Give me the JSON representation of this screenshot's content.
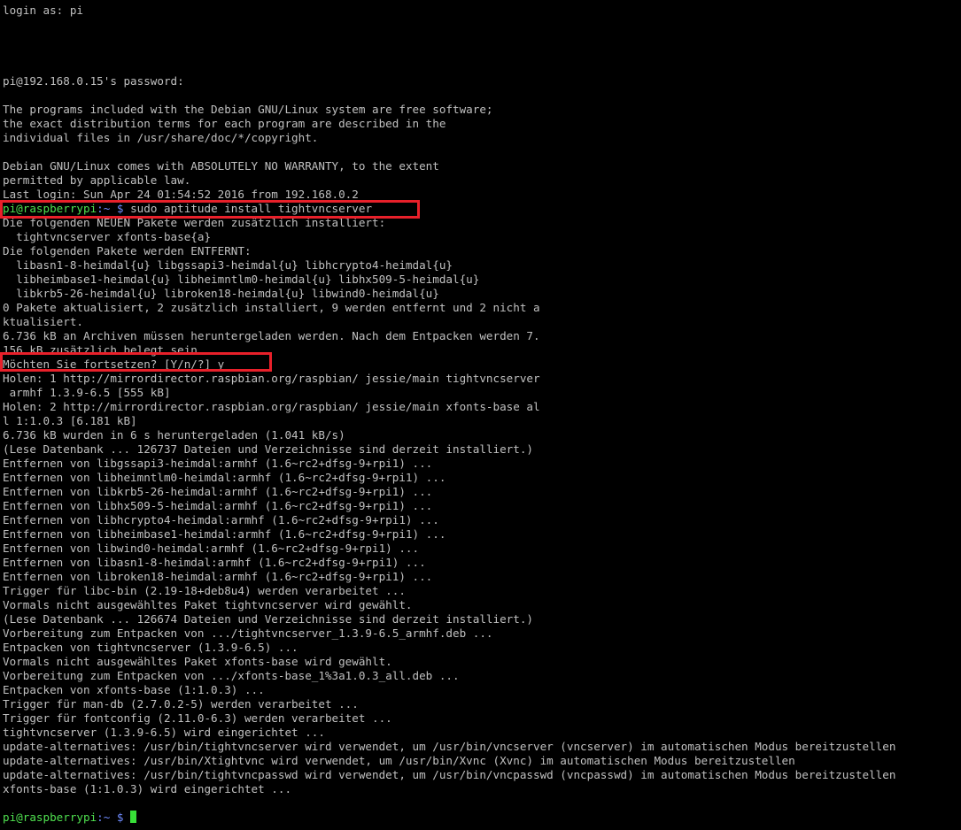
{
  "terminal": {
    "colors": {
      "background": "#000000",
      "foreground": "#c0c0c0",
      "prompt_user": "#4fe04f",
      "prompt_path": "#6f8bff",
      "highlight": "#e8202a"
    },
    "lines": [
      "login as: pi",
      "",
      "",
      "",
      "",
      "pi@192.168.0.15's password:",
      "",
      "The programs included with the Debian GNU/Linux system are free software;",
      "the exact distribution terms for each program are described in the",
      "individual files in /usr/share/doc/*/copyright.",
      "",
      "Debian GNU/Linux comes with ABSOLUTELY NO WARRANTY, to the extent",
      "permitted by applicable law.",
      "Last login: Sun Apr 24 01:54:52 2016 from 192.168.0.2"
    ],
    "command_prompt": {
      "user_host": "pi@raspberrypi",
      "path": ":~",
      "symbol": " $ ",
      "command": "sudo aptitude install tightvncserver"
    },
    "output_lines": [
      "Die folgenden NEUEN Pakete werden zusätzlich installiert:",
      "  tightvncserver xfonts-base{a}",
      "Die folgenden Pakete werden ENTFERNT:",
      "  libasn1-8-heimdal{u} libgssapi3-heimdal{u} libhcrypto4-heimdal{u}",
      "  libheimbase1-heimdal{u} libheimntlm0-heimdal{u} libhx509-5-heimdal{u}",
      "  libkrb5-26-heimdal{u} libroken18-heimdal{u} libwind0-heimdal{u}",
      "0 Pakete aktualisiert, 2 zusätzlich installiert, 9 werden entfernt und 2 nicht a",
      "ktualisiert.",
      "6.736 kB an Archiven müssen heruntergeladen werden. Nach dem Entpacken werden 7.",
      "156 kB zusätzlich belegt sein."
    ],
    "confirm_line": "Möchten Sie fortsetzen? [Y/n/?] y",
    "install_lines": [
      "Holen: 1 http://mirrordirector.raspbian.org/raspbian/ jessie/main tightvncserver",
      " armhf 1.3.9-6.5 [555 kB]",
      "Holen: 2 http://mirrordirector.raspbian.org/raspbian/ jessie/main xfonts-base al",
      "l 1:1.0.3 [6.181 kB]",
      "6.736 kB wurden in 6 s heruntergeladen (1.041 kB/s)",
      "(Lese Datenbank ... 126737 Dateien und Verzeichnisse sind derzeit installiert.)",
      "Entfernen von libgssapi3-heimdal:armhf (1.6~rc2+dfsg-9+rpi1) ...",
      "Entfernen von libheimntlm0-heimdal:armhf (1.6~rc2+dfsg-9+rpi1) ...",
      "Entfernen von libkrb5-26-heimdal:armhf (1.6~rc2+dfsg-9+rpi1) ...",
      "Entfernen von libhx509-5-heimdal:armhf (1.6~rc2+dfsg-9+rpi1) ...",
      "Entfernen von libhcrypto4-heimdal:armhf (1.6~rc2+dfsg-9+rpi1) ...",
      "Entfernen von libheimbase1-heimdal:armhf (1.6~rc2+dfsg-9+rpi1) ...",
      "Entfernen von libwind0-heimdal:armhf (1.6~rc2+dfsg-9+rpi1) ...",
      "Entfernen von libasn1-8-heimdal:armhf (1.6~rc2+dfsg-9+rpi1) ...",
      "Entfernen von libroken18-heimdal:armhf (1.6~rc2+dfsg-9+rpi1) ...",
      "Trigger für libc-bin (2.19-18+deb8u4) werden verarbeitet ...",
      "Vormals nicht ausgewähltes Paket tightvncserver wird gewählt.",
      "(Lese Datenbank ... 126674 Dateien und Verzeichnisse sind derzeit installiert.)",
      "Vorbereitung zum Entpacken von .../tightvncserver_1.3.9-6.5_armhf.deb ...",
      "Entpacken von tightvncserver (1.3.9-6.5) ...",
      "Vormals nicht ausgewähltes Paket xfonts-base wird gewählt.",
      "Vorbereitung zum Entpacken von .../xfonts-base_1%3a1.0.3_all.deb ...",
      "Entpacken von xfonts-base (1:1.0.3) ...",
      "Trigger für man-db (2.7.0.2-5) werden verarbeitet ...",
      "Trigger für fontconfig (2.11.0-6.3) werden verarbeitet ...",
      "tightvncserver (1.3.9-6.5) wird eingerichtet ...",
      "update-alternatives: /usr/bin/tightvncserver wird verwendet, um /usr/bin/vncserver (vncserver) im automatischen Modus bereitzustellen",
      "update-alternatives: /usr/bin/Xtightvnc wird verwendet, um /usr/bin/Xvnc (Xvnc) im automatischen Modus bereitzustellen",
      "update-alternatives: /usr/bin/tightvncpasswd wird verwendet, um /usr/bin/vncpasswd (vncpasswd) im automatischen Modus bereitzustellen",
      "xfonts-base (1:1.0.3) wird eingerichtet ...",
      ""
    ],
    "final_prompt": {
      "user_host": "pi@raspberrypi",
      "path": ":~",
      "symbol": " $ "
    }
  }
}
